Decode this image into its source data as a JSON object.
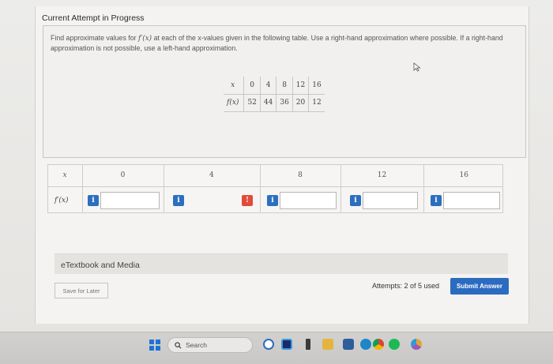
{
  "header": {
    "current_attempt": "Current Attempt in Progress"
  },
  "question": {
    "text_pre": "Find approximate values for",
    "fprime": "f′(x)",
    "text_post": "at each of the x-values given in the following table. Use a right-hand approximation where possible. If a right-hand approximation is not possible, use a left-hand approximation."
  },
  "given_table": {
    "x_label": "x",
    "fx_label": "f(x)",
    "x_values": [
      "0",
      "4",
      "8",
      "12",
      "16"
    ],
    "fx_values": [
      "52",
      "44",
      "36",
      "20",
      "12"
    ]
  },
  "answer_table": {
    "x_label": "x",
    "fprime_label": "f′(x)",
    "headers": [
      "0",
      "4",
      "8",
      "12",
      "16"
    ]
  },
  "etextbook": {
    "label": "eTextbook and Media"
  },
  "footer": {
    "save_label": "Save for Later",
    "attempts": "Attempts: 2 of 5 used",
    "submit_label": "Submit Answer"
  },
  "taskbar": {
    "search_label": "Search",
    "icons": [
      "start-icon",
      "search-icon",
      "bing-icon",
      "widget-icon",
      "file-explorer-icon",
      "store-icon",
      "edge-icon",
      "chrome-icon",
      "spotify-icon",
      "chrome-canary-icon"
    ]
  },
  "colors": {
    "accent": "#2b6cc0",
    "alert": "#e04b3c"
  }
}
